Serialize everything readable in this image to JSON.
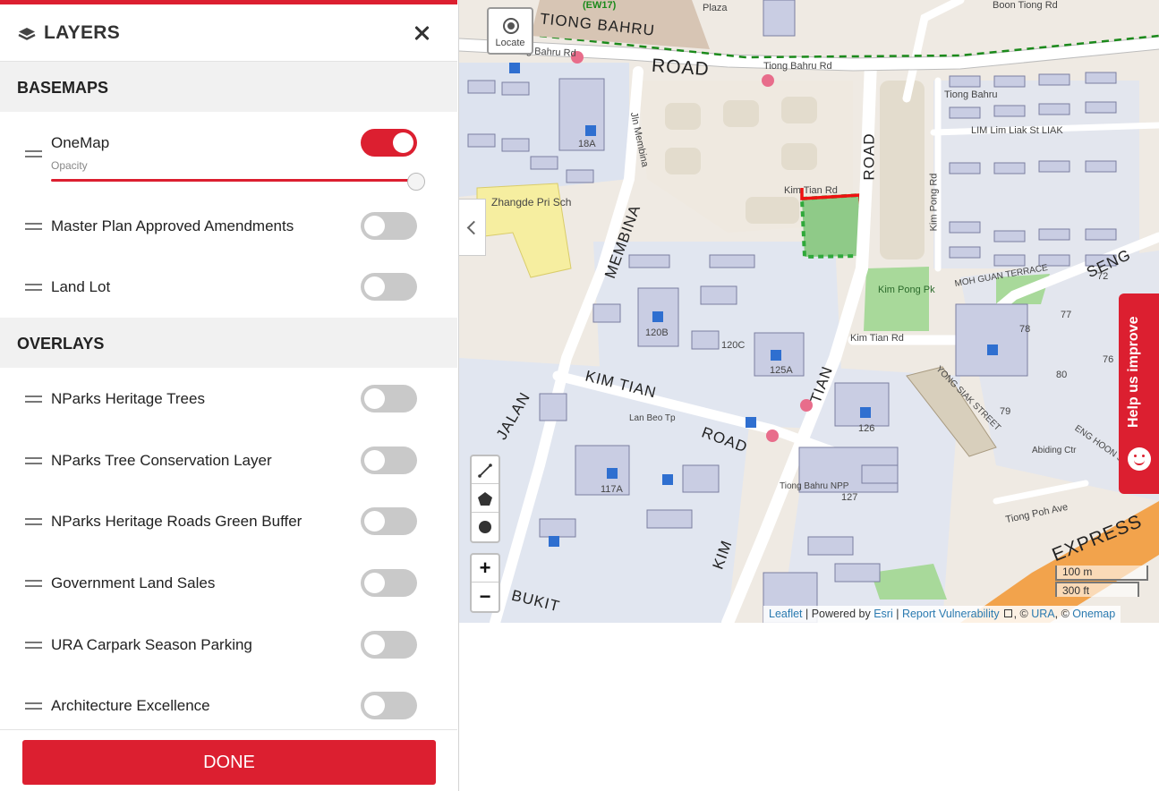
{
  "panel": {
    "title": "LAYERS",
    "close_icon": "close-icon",
    "layers_icon": "stacked-layers-icon",
    "done_label": "DONE",
    "accent": "#dc1f30",
    "basemaps": {
      "heading": "BASEMAPS",
      "items": [
        {
          "label": "OneMap",
          "on": true,
          "opacity_label": "Opacity",
          "opacity": 1.0
        },
        {
          "label": "Master Plan Approved Amendments",
          "on": false
        },
        {
          "label": "Land Lot",
          "on": false
        }
      ]
    },
    "overlays": {
      "heading": "OVERLAYS",
      "items": [
        {
          "label": "NParks Heritage Trees",
          "on": false
        },
        {
          "label": "NParks Tree Conservation Layer",
          "on": false
        },
        {
          "label": "NParks Heritage Roads Green Buffer",
          "on": false
        },
        {
          "label": "Government Land Sales",
          "on": false
        },
        {
          "label": "URA Carpark Season Parking",
          "on": false
        },
        {
          "label": "Architecture Excellence",
          "on": false
        }
      ]
    }
  },
  "map": {
    "locate_label": "Locate",
    "feedback_label": "Help us improve",
    "zoom_in": "+",
    "zoom_out": "−",
    "scale_metric": "100 m",
    "scale_imperial": "300 ft",
    "attribution": {
      "leaflet": "Leaflet",
      "sep1": " | Powered by ",
      "esri": "Esri",
      "sep2": " | ",
      "report": "Report Vulnerability",
      "sep3": ", © ",
      "ura": "URA",
      "sep4": ", © ",
      "onemap": "Onemap"
    },
    "labels": {
      "road_tiong_bahru": "ROAD",
      "tiong_bahru_rd_1": "Tiong Bahru Rd",
      "tiong_bahru_rd_2": "Tiong Bahru Rd",
      "tiong_bahru_big": "TIONG BAHRU",
      "boon_tiong_rd": "Boon Tiong Rd",
      "ew17": "(EW17)",
      "plaza": "Plaza",
      "membina": "MEMBINA",
      "jln_membina": "Jln Membina",
      "zhangde": "Zhangde Pri Sch",
      "kim_tian_rd": "Kim Tian Rd",
      "kim_tian_rd_2": "Kim Tian Rd",
      "kim_tian": "KIM TIAN",
      "road_2": "ROAD",
      "jalan": "JALAN",
      "road_vertical": "ROAD",
      "tian": "TIAN",
      "kim": "KIM",
      "kim_pong_pk": "Kim Pong Pk",
      "kim_pong_rd": "Kim Pong Rd",
      "lim_liak": "LIM  Lim Liak St LIAK",
      "tiong_bahru_small": "Tiong Bahru",
      "seng": "SENG",
      "moh_guan": "MOH GUAN TERRACE",
      "yong_siak": "YONG SIAK STREET",
      "eng_hoon": "ENG HOON STREET",
      "expressway": "EXPRESS",
      "tiong_poh_ave": "Tiong Poh Ave",
      "lan_beo_tp": "Lan Beo Tp",
      "abiding_ctr": "Abiding Ctr",
      "tiong_bahru_npp": "Tiong Bahru NPP",
      "bukit": "BUKIT",
      "block_18a": "18A",
      "block_120b": "120B",
      "block_120c": "120C",
      "block_125a": "125A",
      "block_126": "126",
      "block_127": "127",
      "block_117a": "117A",
      "block_72": "72",
      "block_78": "78",
      "block_79": "79",
      "block_80": "80",
      "block_77": "77",
      "block_76": "76"
    }
  }
}
